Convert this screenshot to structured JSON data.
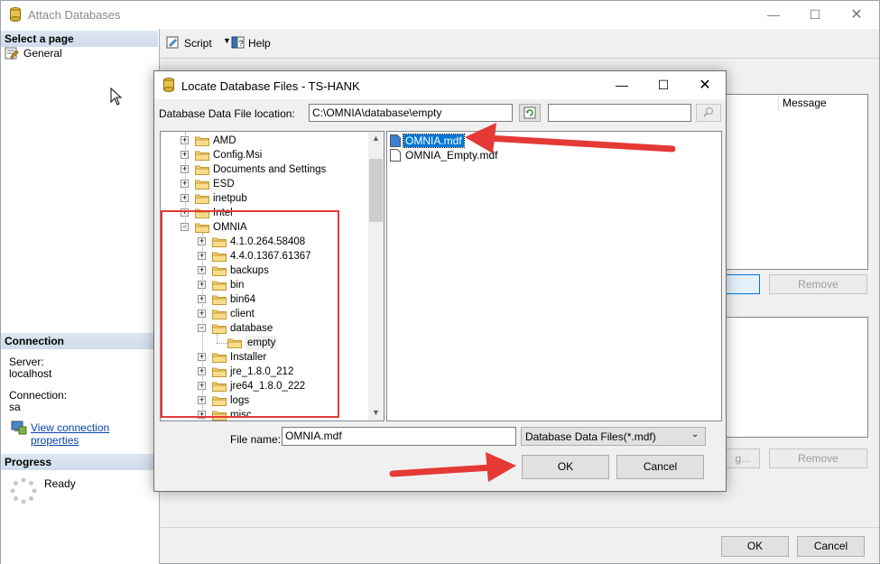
{
  "outer_window": {
    "title": "Attach Databases",
    "toolbar": {
      "script_label": "Script",
      "help_label": "Help"
    },
    "select_page_header": "Select a page",
    "pages": [
      {
        "label": "General"
      }
    ],
    "connection_header": "Connection",
    "server_label": "Server:",
    "server_value": "localhost",
    "connection_label": "Connection:",
    "connection_value": "sa",
    "view_connection_link": "View connection properties",
    "progress_header": "Progress",
    "progress_status": "Ready",
    "grid_column_message": "Message",
    "remove_label_1": "Remove",
    "remove_label_2": "Remove",
    "add_partial_label": "g...",
    "ok_label": "OK",
    "cancel_label": "Cancel"
  },
  "dialog": {
    "title": "Locate Database Files - TS-HANK",
    "location_label": "Database Data File location:",
    "location_value": "C:\\OMNIA\\database\\empty",
    "search_value": "",
    "tree": [
      {
        "label": "AMD",
        "level": 0
      },
      {
        "label": "Config.Msi",
        "level": 0
      },
      {
        "label": "Documents and Settings",
        "level": 0
      },
      {
        "label": "ESD",
        "level": 0
      },
      {
        "label": "inetpub",
        "level": 0
      },
      {
        "label": "Intel",
        "level": 0
      },
      {
        "label": "OMNIA",
        "level": 0
      },
      {
        "label": "4.1.0.264.58408",
        "level": 1
      },
      {
        "label": "4.4.0.1367.61367",
        "level": 1
      },
      {
        "label": "backups",
        "level": 1
      },
      {
        "label": "bin",
        "level": 1
      },
      {
        "label": "bin64",
        "level": 1
      },
      {
        "label": "client",
        "level": 1
      },
      {
        "label": "database",
        "level": 1
      },
      {
        "label": "empty",
        "level": 2
      },
      {
        "label": "Installer",
        "level": 1
      },
      {
        "label": "jre_1.8.0_212",
        "level": 1
      },
      {
        "label": "jre64_1.8.0_222",
        "level": 1
      },
      {
        "label": "logs",
        "level": 1
      },
      {
        "label": "misc",
        "level": 1
      }
    ],
    "files": [
      {
        "label": "OMNIA.mdf",
        "selected": true
      },
      {
        "label": "OMNIA_Empty.mdf",
        "selected": false
      }
    ],
    "file_name_label": "File name:",
    "file_name_value": "OMNIA.mdf",
    "file_type_value": "Database Data Files(*.mdf)",
    "ok_label": "OK",
    "cancel_label": "Cancel"
  },
  "colors": {
    "selection": "#0078d7",
    "annotation_red": "#e53935",
    "link": "#0645ad"
  }
}
